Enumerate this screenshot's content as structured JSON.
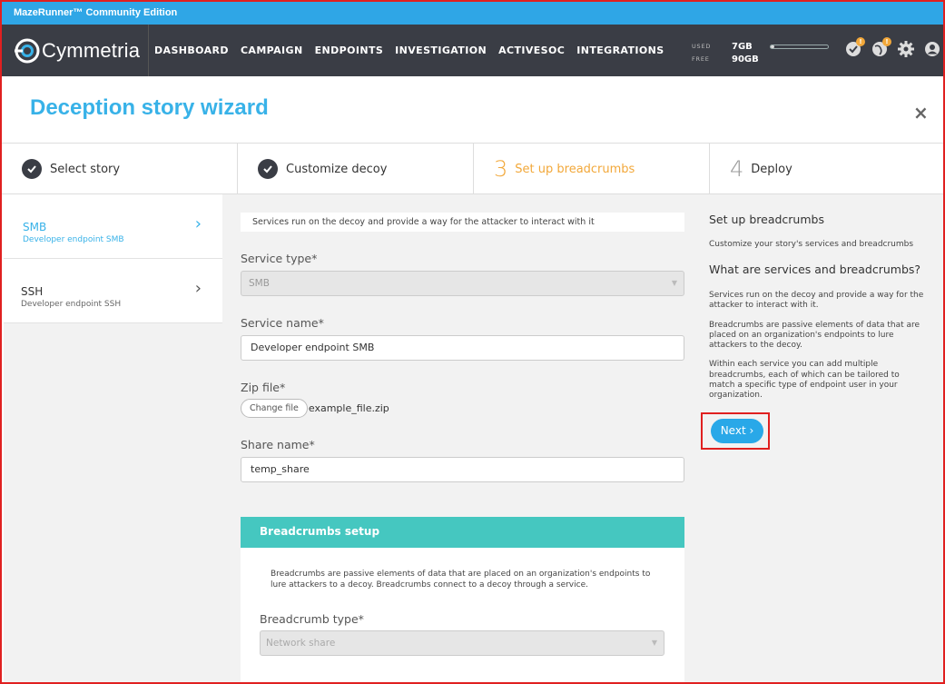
{
  "window": {
    "title": "MazeRunner™ Community Edition"
  },
  "brand": {
    "logo_text": "Cymmetria"
  },
  "nav": {
    "items": [
      "DASHBOARD",
      "CAMPAIGN",
      "ENDPOINTS",
      "INVESTIGATION",
      "ACTIVESOC",
      "INTEGRATIONS"
    ],
    "usage": {
      "used_label": "USED",
      "used_value": "7GB",
      "free_label": "FREE",
      "free_value": "90GB",
      "used_fraction": 0.07
    },
    "icons": [
      "alerts-icon",
      "globe-alerts-icon",
      "gear-icon",
      "user-icon"
    ],
    "badges": [
      "!",
      "!"
    ]
  },
  "wizard": {
    "title": "Deception story wizard",
    "close_label": "×",
    "steps": [
      {
        "num": "",
        "label": "Select story",
        "state": "done"
      },
      {
        "num": "",
        "label": "Customize decoy",
        "state": "done"
      },
      {
        "num": "3",
        "label": "Set up breadcrumbs",
        "state": "active"
      },
      {
        "num": "4",
        "label": "Deploy",
        "state": "future"
      }
    ]
  },
  "services": [
    {
      "name": "SMB",
      "subtitle": "Developer endpoint SMB",
      "selected": true
    },
    {
      "name": "SSH",
      "subtitle": "Developer endpoint SSH",
      "selected": false
    }
  ],
  "form": {
    "intro": "Services run on the decoy and provide a way for the attacker to interact with it",
    "service_type_label": "Service type*",
    "service_type_value": "SMB",
    "service_name_label": "Service name*",
    "service_name_value": "Developer endpoint SMB",
    "zip_label": "Zip file*",
    "change_file_label": "Change file",
    "file_name": "example_file.zip",
    "share_name_label": "Share name*",
    "share_name_value": "temp_share"
  },
  "breadcrumbs": {
    "header": "Breadcrumbs setup",
    "text": "Breadcrumbs are passive elements of data that are placed on an organization's endpoints to lure attackers to a decoy. Breadcrumbs connect to a decoy through a service.",
    "type_label": "Breadcrumb type*",
    "type_value": "Network share"
  },
  "help": {
    "title": "Set up breadcrumbs",
    "subtitle": "Customize your story's services and breadcrumbs",
    "heading": "What are services and breadcrumbs?",
    "p1": "Services run on the decoy and provide a way for the attacker to interact with it.",
    "p2": "Breadcrumbs are passive elements of data that are placed on an organization's endpoints to lure attackers to the decoy.",
    "p3": "Within each service you can add multiple breadcrumbs, each of which can be tailored to match a specific type of endpoint user in your organization.",
    "next_label": "Next ›"
  },
  "colors": {
    "accent": "#38b2e8",
    "active_step": "#f2a83a",
    "teal": "#45c7c0",
    "nav_bg": "#3a3d45",
    "titlebar": "#2fa6e6"
  }
}
